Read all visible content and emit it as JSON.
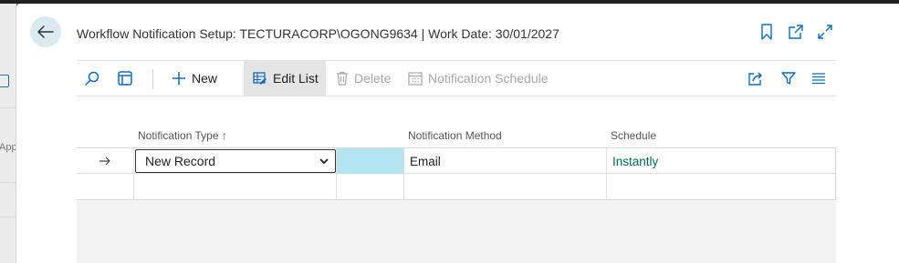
{
  "left_strip": {
    "partial_text": "App"
  },
  "header": {
    "title": "Workflow Notification Setup: TECTURACORP\\OGONG9634 | Work Date: 30/01/2027",
    "icons": [
      "back-arrow-icon",
      "bookmark-icon",
      "open-new-window-icon",
      "expand-icon"
    ]
  },
  "actions": {
    "new_label": "New",
    "edit_list_label": "Edit List",
    "delete_label": "Delete",
    "notification_schedule_label": "Notification Schedule",
    "icons": [
      "search-icon",
      "layout-icon",
      "plus-icon",
      "edit-list-icon",
      "trash-icon",
      "calendar-icon",
      "share-icon",
      "filter-icon",
      "list-view-icon"
    ]
  },
  "columns": {
    "notification_type": "Notification Type ↑",
    "notification_method": "Notification Method",
    "schedule": "Schedule"
  },
  "rows": [
    {
      "notification_type": "New Record",
      "notification_method": "Email",
      "schedule": "Instantly"
    },
    {
      "notification_type": "",
      "notification_method": "",
      "schedule": ""
    }
  ],
  "colors": {
    "accent": "#00695c",
    "back_button_bg": "#dbeaf1",
    "highlight": "#b3e5f0"
  }
}
